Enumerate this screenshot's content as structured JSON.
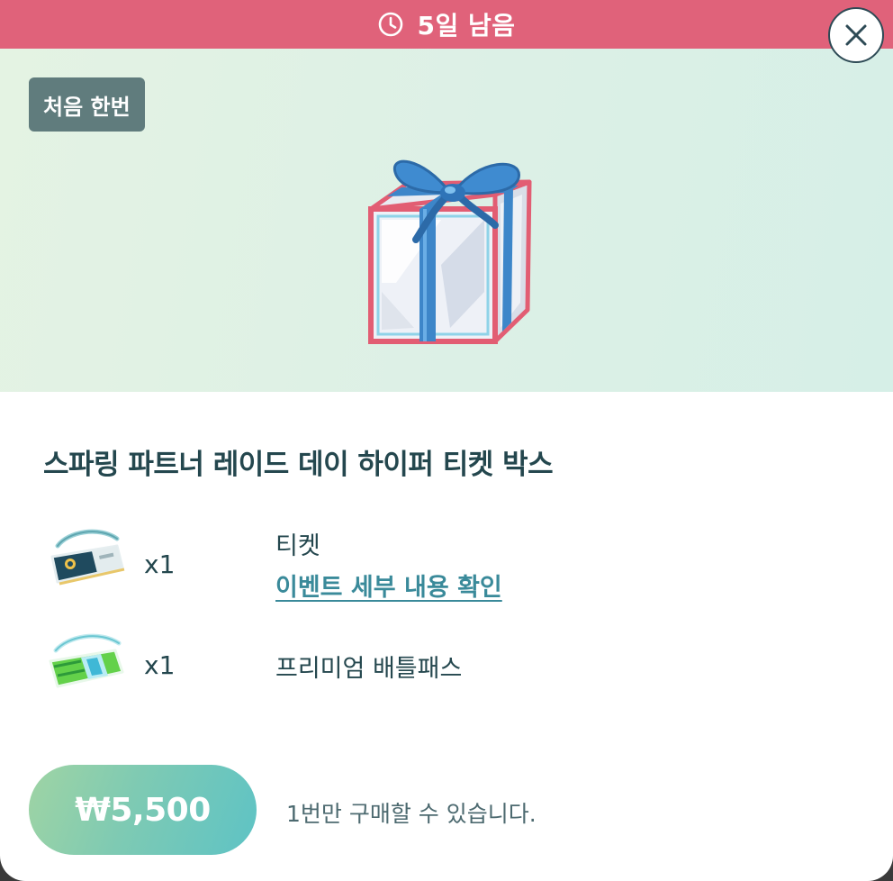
{
  "timer": {
    "text": "5일 남음",
    "icon": "clock-icon"
  },
  "close": {
    "icon": "close-icon"
  },
  "badge": {
    "label": "처음 한번"
  },
  "product": {
    "image": "gift-box-icon",
    "title": "스파링 파트너 레이드 데이 하이퍼 티켓 박스"
  },
  "items": [
    {
      "icon": "ticket-icon",
      "qty": "x1",
      "name": "티켓",
      "link": "이벤트 세부 내용 확인"
    },
    {
      "icon": "premium-battle-pass-icon",
      "qty": "x1",
      "name": "프리미엄 배틀패스"
    }
  ],
  "purchase": {
    "price": "₩5,500",
    "note": "1번만 구매할 수 있습니다."
  },
  "colors": {
    "timer_bar": "#e0627a",
    "badge": "#607c7d",
    "title_text": "#24474e",
    "link": "#3a8a9a",
    "price_gradient_start": "#9fd4a4",
    "price_gradient_end": "#5ec3c5"
  }
}
